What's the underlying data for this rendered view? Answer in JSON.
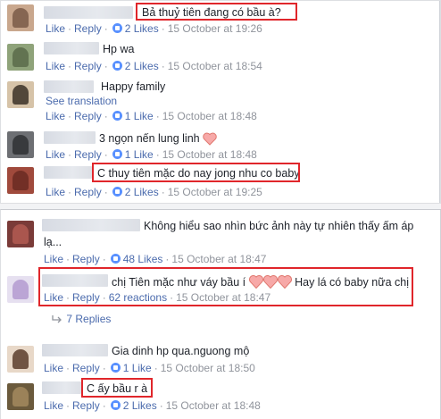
{
  "panel1": {
    "comments": [
      {
        "text": "Bả thuỷ tiên đang có bầu à?",
        "actions": {
          "like": "Like",
          "reply": "Reply",
          "likes": "2 Likes",
          "time": "15 October at 19:26"
        }
      },
      {
        "text": "Hp wa",
        "actions": {
          "like": "Like",
          "reply": "Reply",
          "likes": "2 Likes",
          "time": "15 October at 18:54"
        }
      },
      {
        "text": "Happy family",
        "see_translation": "See translation",
        "actions": {
          "like": "Like",
          "reply": "Reply",
          "likes": "1 Like",
          "time": "15 October at 18:48"
        }
      },
      {
        "text": "3 ngọn nến lung linh",
        "actions": {
          "like": "Like",
          "reply": "Reply",
          "likes": "1 Like",
          "time": "15 October at 18:48"
        }
      },
      {
        "text": "C thuy tiên mặc do nay jong nhu co baby",
        "actions": {
          "like": "Like",
          "reply": "Reply",
          "likes": "2 Likes",
          "time": "15 October at 19:25"
        }
      }
    ]
  },
  "panel2": {
    "comments": [
      {
        "text_line1": "Không hiểu sao nhìn bức ảnh này tự nhiên thấy ấm áp",
        "text_line2": "lạ...",
        "actions": {
          "like": "Like",
          "reply": "Reply",
          "likes": "48 Likes",
          "time": "15 October at 18:47"
        }
      },
      {
        "text_before": "chị Tiên mặc như váy bầu í",
        "text_after": "Hay lá có baby nữa chị",
        "actions": {
          "like": "Like",
          "reply": "Reply",
          "likes": "62 reactions",
          "time": "15 October at 18:47"
        },
        "replies": "7 Replies"
      },
      {
        "text": "Gia dinh hp qua.nguong mộ",
        "actions": {
          "like": "Like",
          "reply": "Reply",
          "likes": "1 Like",
          "time": "15 October at 18:50"
        }
      },
      {
        "text": "C ấy bầu r à",
        "actions": {
          "like": "Like",
          "reply": "Reply",
          "likes": "2 Likes",
          "time": "15 October at 18:48"
        }
      }
    ]
  },
  "colors": {
    "link": "#4b6bad",
    "meta": "#90949c",
    "highlight_box": "#e0262b",
    "heart": "#f7a9a8"
  }
}
